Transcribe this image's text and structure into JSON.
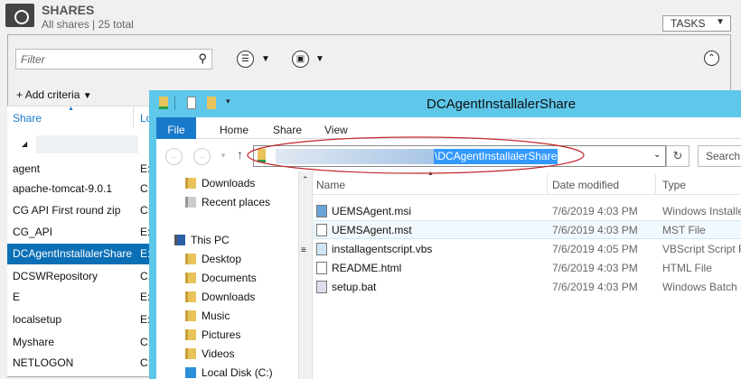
{
  "header": {
    "title": "SHARES",
    "subtitle": "All shares | 25 total",
    "tasks_label": "TASKS"
  },
  "filter": {
    "placeholder": "Filter"
  },
  "add_criteria": "Add criteria",
  "columns": {
    "share": "Share",
    "location": "Lo"
  },
  "shares": [
    {
      "name": "agent",
      "loc": "E:\\"
    },
    {
      "name": "apache-tomcat-9.0.1",
      "loc": "C:\\"
    },
    {
      "name": "CG API First round zip",
      "loc": "C:\\"
    },
    {
      "name": "CG_API",
      "loc": "E:\\"
    },
    {
      "name": "DCAgentInstallalerShare",
      "loc": "E:\\",
      "selected": true
    },
    {
      "name": "DCSWRepository",
      "loc": "C:\\"
    },
    {
      "name": "E",
      "loc": "E:\\"
    },
    {
      "name": "localsetup",
      "loc": "E:\\"
    },
    {
      "name": "Myshare",
      "loc": "C:\\"
    },
    {
      "name": "NETLOGON",
      "loc": "C:\\"
    }
  ],
  "explorer": {
    "title": "DCAgentInstallalerShare",
    "tabs": [
      "File",
      "Home",
      "Share",
      "View"
    ],
    "address": "\\DCAgentInstallalerShare",
    "search_placeholder": "Search",
    "nav": [
      "Downloads",
      "Recent places",
      "This PC",
      "Desktop",
      "Documents",
      "Downloads",
      "Music",
      "Pictures",
      "Videos",
      "Local Disk (C:)"
    ],
    "columns": [
      "Name",
      "Date modified",
      "Type"
    ],
    "files": [
      {
        "name": "UEMSAgent.msi",
        "date": "7/6/2019 4:03 PM",
        "type": "Windows Installe"
      },
      {
        "name": "UEMSAgent.mst",
        "date": "7/6/2019 4:03 PM",
        "type": "MST File"
      },
      {
        "name": "installagentscript.vbs",
        "date": "7/6/2019 4:05 PM",
        "type": "VBScript Script Fi"
      },
      {
        "name": "README.html",
        "date": "7/6/2019 4:03 PM",
        "type": "HTML File"
      },
      {
        "name": "setup.bat",
        "date": "7/6/2019 4:03 PM",
        "type": "Windows Batch F"
      }
    ]
  },
  "colors": {
    "selection": "#0b6fb6",
    "titlebar": "#5ec7ea",
    "file_tab": "#1979ca",
    "annotation": "#c0282c"
  }
}
